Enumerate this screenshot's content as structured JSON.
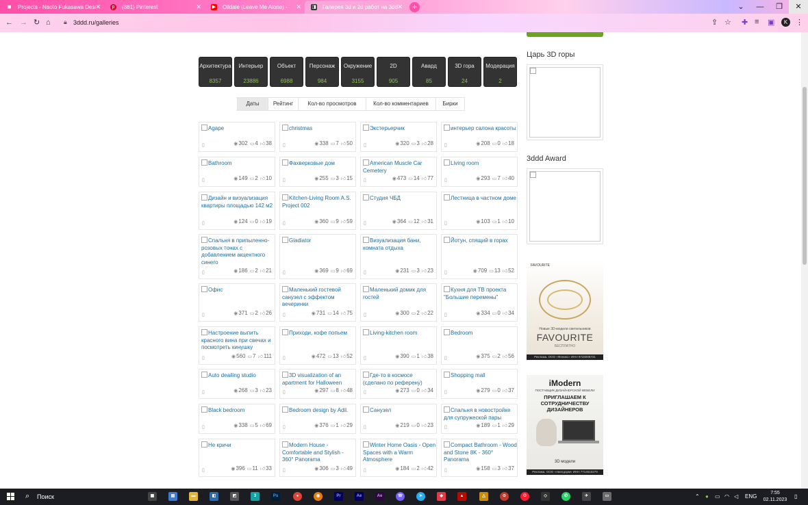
{
  "browser": {
    "tabs": [
      {
        "title": "Projects - Naoto Fukasawa Desi",
        "icon_color": "#ff4fa8",
        "active": false
      },
      {
        "title": "(881) Pinterest",
        "icon_color": "#e60023",
        "active": false
      },
      {
        "title": "Oildale (Leave Me Alone) -",
        "icon_color": "#ff0000",
        "active": false
      },
      {
        "title": "Галерея 3d и 2d работ на 3dd",
        "icon_color": "#333333",
        "active": true
      }
    ],
    "url": "3ddd.ru/galleries"
  },
  "categories": [
    {
      "label": "Архитектура",
      "count": "8357"
    },
    {
      "label": "Интерьер",
      "count": "23886"
    },
    {
      "label": "Объект",
      "count": "6988"
    },
    {
      "label": "Персонаж",
      "count": "984"
    },
    {
      "label": "Окружение",
      "count": "3155"
    },
    {
      "label": "2D",
      "count": "905"
    },
    {
      "label": "Авард",
      "count": "85"
    },
    {
      "label": "3D гора",
      "count": "24"
    },
    {
      "label": "Модерация",
      "count": "2"
    }
  ],
  "sort_tabs": [
    "Даты",
    "Рейтинг",
    "Кол-во просмотров",
    "Кол-во комментариев",
    "Бирки"
  ],
  "gallery": [
    {
      "title": "Agape",
      "views": "302",
      "comments": "4",
      "likes": "38"
    },
    {
      "title": "christmas",
      "views": "338",
      "comments": "7",
      "likes": "50"
    },
    {
      "title": "Экстерьерчик",
      "views": "320",
      "comments": "3",
      "likes": "28"
    },
    {
      "title": "интерьер салона красоты",
      "views": "208",
      "comments": "0",
      "likes": "18"
    },
    {
      "title": "Bathroom",
      "views": "149",
      "comments": "2",
      "likes": "10"
    },
    {
      "title": "Фахверковые дом",
      "views": "255",
      "comments": "3",
      "likes": "15"
    },
    {
      "title": "American Muscle Car Cemetery",
      "views": "473",
      "comments": "14",
      "likes": "77"
    },
    {
      "title": "Living room",
      "views": "293",
      "comments": "7",
      "likes": "40"
    },
    {
      "title": "Дизайн и визуализация квартиры площадью 142 м2",
      "views": "124",
      "comments": "0",
      "likes": "19"
    },
    {
      "title": "Kitchen-Living Room A.S. Project 002",
      "views": "360",
      "comments": "9",
      "likes": "59"
    },
    {
      "title": "Студия ЧБД",
      "views": "364",
      "comments": "12",
      "likes": "31"
    },
    {
      "title": "Лестница в частном доме",
      "views": "103",
      "comments": "1",
      "likes": "10"
    },
    {
      "title": "Спальня в припыленно-розовых тонах с добавлением акцентного синего",
      "views": "186",
      "comments": "2",
      "likes": "21"
    },
    {
      "title": "Gladiator",
      "views": "369",
      "comments": "9",
      "likes": "69"
    },
    {
      "title": "Визуализация бани, комната отдыха",
      "views": "231",
      "comments": "3",
      "likes": "23"
    },
    {
      "title": "Йотун, спящий в горах",
      "views": "709",
      "comments": "13",
      "likes": "52"
    },
    {
      "title": "Офис",
      "views": "371",
      "comments": "2",
      "likes": "26"
    },
    {
      "title": "Маленький гостевой санузел с эффектом вечеринки",
      "views": "731",
      "comments": "14",
      "likes": "75"
    },
    {
      "title": "Маленький домик для гостей",
      "views": "300",
      "comments": "2",
      "likes": "22"
    },
    {
      "title": "Кухня для ТВ проекта \"Большие перемены\"",
      "views": "334",
      "comments": "0",
      "likes": "34"
    },
    {
      "title": "Настроение выпить красного вина при свечах и посмотреть кинушку",
      "views": "560",
      "comments": "7",
      "likes": "111"
    },
    {
      "title": "Приходи, кофе попьем",
      "views": "472",
      "comments": "13",
      "likes": "52"
    },
    {
      "title": "Living-kitchen room",
      "views": "390",
      "comments": "1",
      "likes": "38"
    },
    {
      "title": "Bedroom",
      "views": "375",
      "comments": "2",
      "likes": "56"
    },
    {
      "title": "Auto deailing studio",
      "views": "268",
      "comments": "3",
      "likes": "23"
    },
    {
      "title": "3D visualization of an apartment for Halloween",
      "views": "297",
      "comments": "8",
      "likes": "48"
    },
    {
      "title": "Где-то в космосе (сделано по референу)",
      "views": "273",
      "comments": "0",
      "likes": "34"
    },
    {
      "title": "Shopping mall",
      "views": "279",
      "comments": "0",
      "likes": "37"
    },
    {
      "title": "Black bedroom",
      "views": "338",
      "comments": "5",
      "likes": "69"
    },
    {
      "title": "Bedroom design by Adil.",
      "views": "376",
      "comments": "1",
      "likes": "29"
    },
    {
      "title": "Санузел",
      "views": "219",
      "comments": "0",
      "likes": "23"
    },
    {
      "title": "Спальня в новостройке для супружеской пары",
      "views": "189",
      "comments": "1",
      "likes": "29"
    },
    {
      "title": "Не кричи",
      "views": "396",
      "comments": "11",
      "likes": "33"
    },
    {
      "title": "Modern House - Comfortable and Stylish - 360° Panorama",
      "views": "306",
      "comments": "3",
      "likes": "49"
    },
    {
      "title": "Winter Home Oasis - Open Spaces with a Warm Atmosphere",
      "views": "184",
      "comments": "2",
      "likes": "42"
    },
    {
      "title": "Compact Bathroom - Wood and Stone 8K - 360° Panorama",
      "views": "158",
      "comments": "3",
      "likes": "37"
    }
  ],
  "sidebar": {
    "mountain_title": "Царь 3D горы",
    "award_title": "3ddd Award",
    "ad1": {
      "logo": "FAVOURITE",
      "small": "Новые 3D-модели светильников",
      "big": "FAVOURITE",
      "free": "БЕСПЛАТНО",
      "foot": "Реклама. ООО «Феникс» ИНН 9728008731"
    },
    "ad2": {
      "brand": "iModern",
      "sub": "ПОСТАВЩИК ДИЗАЙНЕРСКОЙ МЕБЕЛИ",
      "invite": "ПРИГЛАШАЕМ К СОТРУДНИЧЕСТВУ ДИЗАЙНЕРОВ",
      "models": "3D модели",
      "foot": "Реклама. ООО «Авелдорм» ИНН 7714610279"
    }
  },
  "taskbar": {
    "search_label": "Поиск",
    "lang": "ENG",
    "time": "7:55",
    "date": "02.11.2023"
  }
}
